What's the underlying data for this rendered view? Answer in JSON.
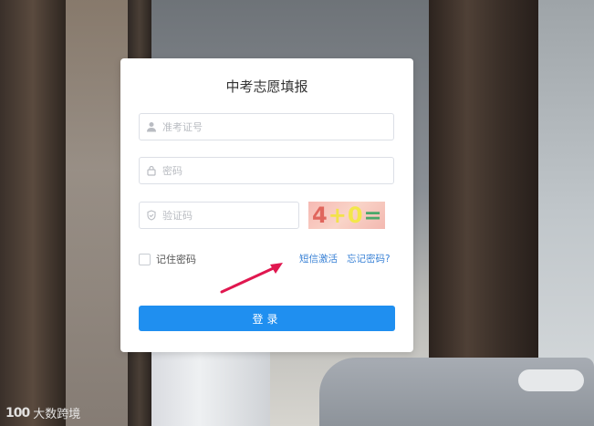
{
  "card": {
    "title": "中考志愿填报"
  },
  "fields": {
    "ticket": {
      "placeholder": "准考证号",
      "icon": "user-icon"
    },
    "password": {
      "placeholder": "密码",
      "icon": "lock-icon"
    },
    "captcha": {
      "placeholder": "验证码",
      "icon": "shield-icon"
    }
  },
  "captcha_image": {
    "text": [
      "4",
      "+",
      "0",
      "="
    ]
  },
  "remember": {
    "label": "记住密码"
  },
  "links": {
    "sms_activate": "短信激活",
    "forgot_password": "忘记密码?"
  },
  "login_button": {
    "label": "登录"
  },
  "watermark": {
    "logo": "100",
    "text": "大数跨境"
  },
  "colors": {
    "primary": "#1f8ff0",
    "link": "#3a82d6",
    "annotation_arrow": "#e0174f"
  }
}
